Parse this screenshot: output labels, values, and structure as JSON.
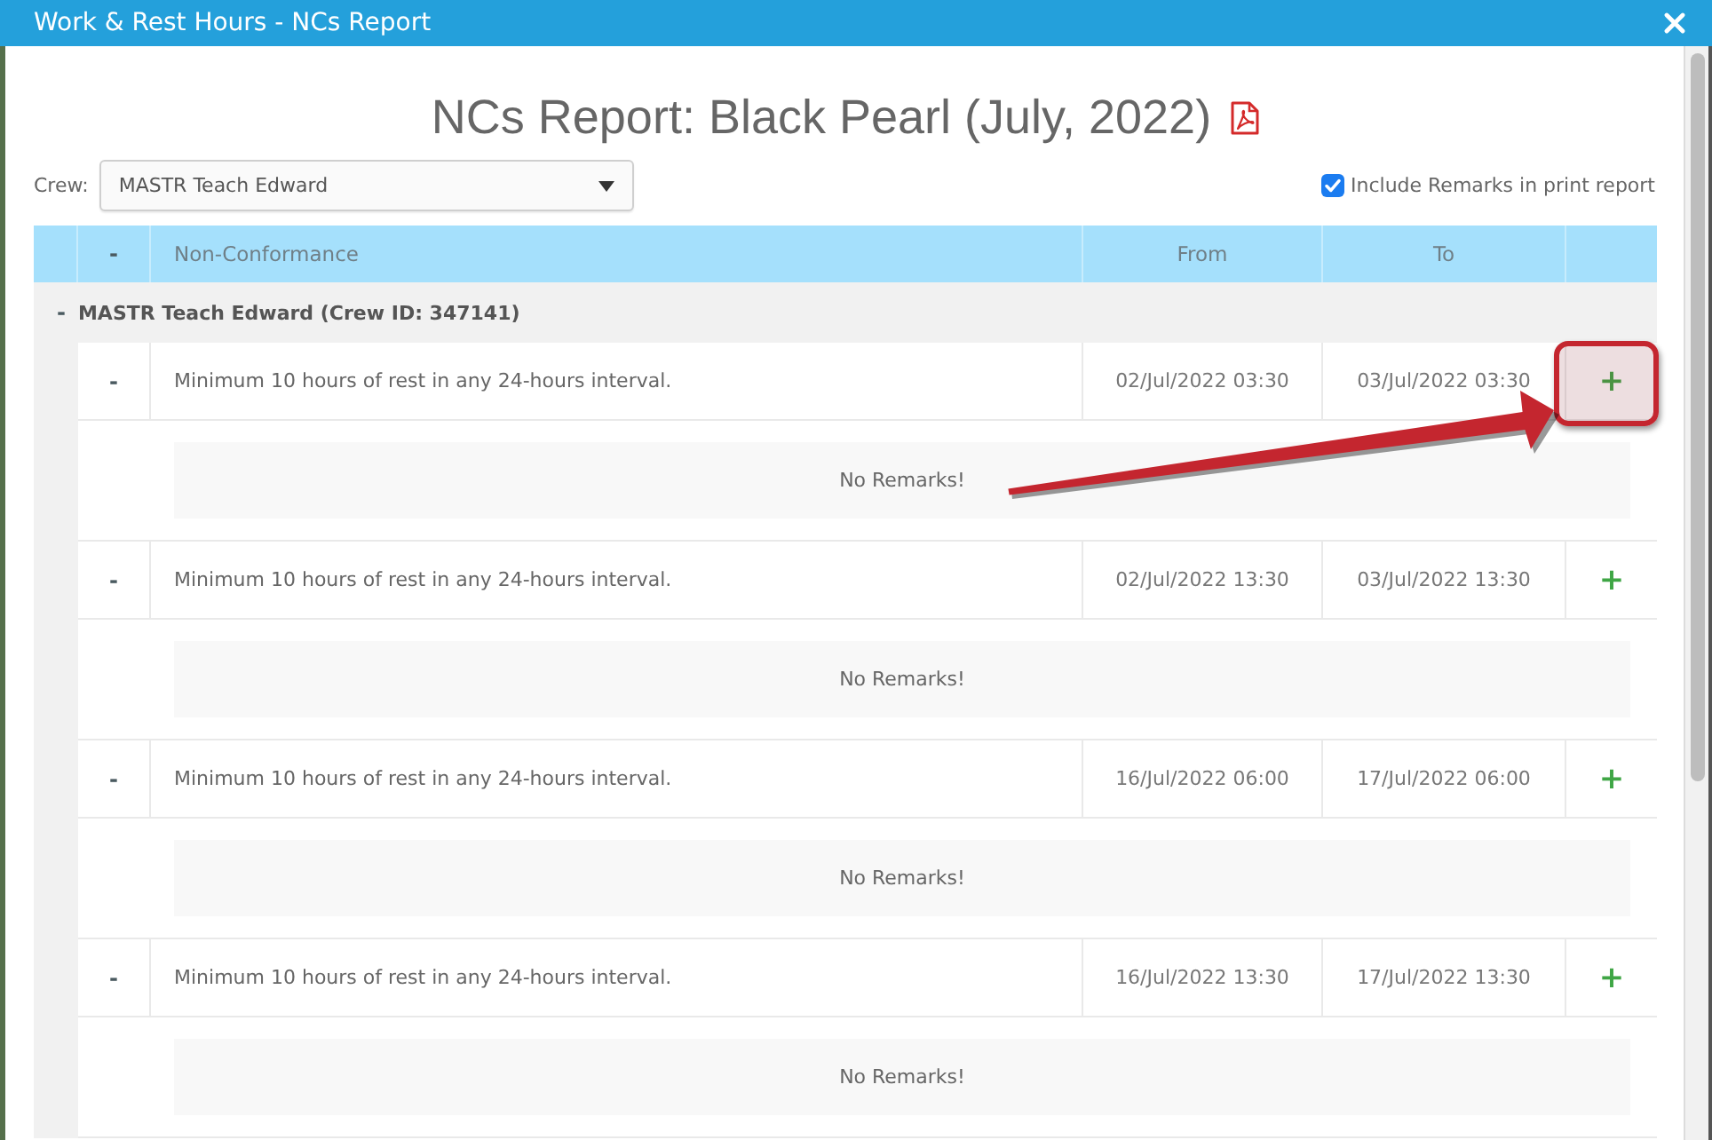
{
  "window": {
    "title": "Work & Rest Hours - NCs Report"
  },
  "report": {
    "title": "NCs Report: Black Pearl (July, 2022)"
  },
  "crew_filter": {
    "label": "Crew:",
    "value": "MASTR Teach Edward"
  },
  "include_remarks": {
    "label": "Include Remarks in print report",
    "checked": true
  },
  "table": {
    "columns": [
      {
        "kind": "toggle",
        "label": "-"
      },
      {
        "kind": "text",
        "label": "Non-Conformance"
      },
      {
        "kind": "date",
        "label": "From"
      },
      {
        "kind": "date",
        "label": "To"
      }
    ],
    "groups": [
      {
        "toggle": "-",
        "title": "MASTR Teach Edward (Crew ID: 347141)",
        "expanded": true,
        "items": [
          {
            "toggle": "-",
            "expanded": true,
            "description": "Minimum 10 hours of rest in any 24-hours interval.",
            "from": "02/Jul/2022 03:30",
            "to": "03/Jul/2022 03:30",
            "add": "+",
            "highlighted": true,
            "remarks": "No Remarks!"
          },
          {
            "toggle": "-",
            "expanded": true,
            "description": "Minimum 10 hours of rest in any 24-hours interval.",
            "from": "02/Jul/2022 13:30",
            "to": "03/Jul/2022 13:30",
            "add": "+",
            "highlighted": false,
            "remarks": "No Remarks!"
          },
          {
            "toggle": "-",
            "expanded": true,
            "description": "Minimum 10 hours of rest in any 24-hours interval.",
            "from": "16/Jul/2022 06:00",
            "to": "17/Jul/2022 06:00",
            "add": "+",
            "highlighted": false,
            "remarks": "No Remarks!"
          },
          {
            "toggle": "-",
            "expanded": true,
            "description": "Minimum 10 hours of rest in any 24-hours interval.",
            "from": "16/Jul/2022 13:30",
            "to": "17/Jul/2022 13:30",
            "add": "+",
            "highlighted": false,
            "remarks": "No Remarks!"
          }
        ]
      }
    ]
  }
}
